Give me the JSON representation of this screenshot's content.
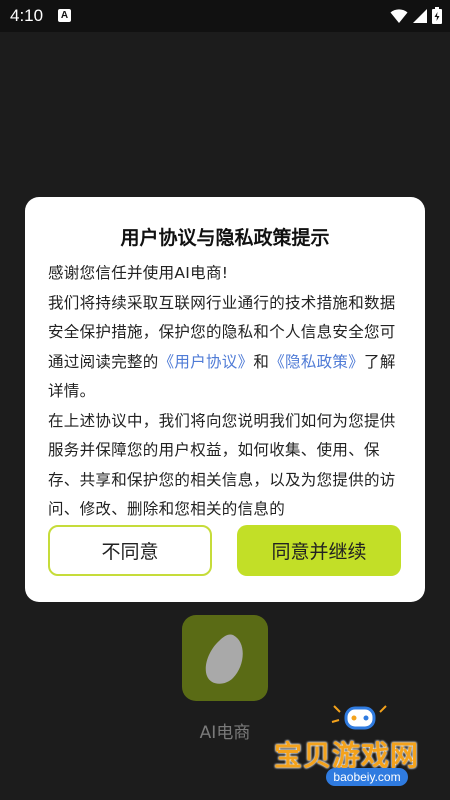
{
  "status_bar": {
    "time": "4:10",
    "notification_icon": "a-icon",
    "wifi_icon": "wifi-icon",
    "signal_icon": "signal-icon",
    "battery_icon": "battery-icon"
  },
  "app": {
    "name": "AI电商",
    "icon": "leaf-icon",
    "icon_color": "#5a6b15"
  },
  "dialog": {
    "title": "用户协议与隐私政策提示",
    "greeting": "感谢您信任并使用AI电商!",
    "para1_before": "我们将持续采取互联网行业通行的技术措施和数据安全保护措施，保护您的隐私和个人信息安全您可通过阅读完整的",
    "user_agreement_link": "《用户协议》",
    "and_text": "和",
    "privacy_policy_link": "《隐私政策》",
    "para1_after": "了解详情。",
    "para2": "在上述协议中，我们将向您说明我们如何为您提供服务并保障您的用户权益，如何收集、使用、保存、共享和保护您的相关信息，以及为您提供的访问、修改、删除和您相关的信息的",
    "disagree_label": "不同意",
    "agree_label": "同意并继续",
    "accent_color": "#c2df27",
    "link_color": "#4f7bd6"
  },
  "watermark": {
    "text": "宝贝游戏网",
    "url": "baobeiy.com"
  }
}
